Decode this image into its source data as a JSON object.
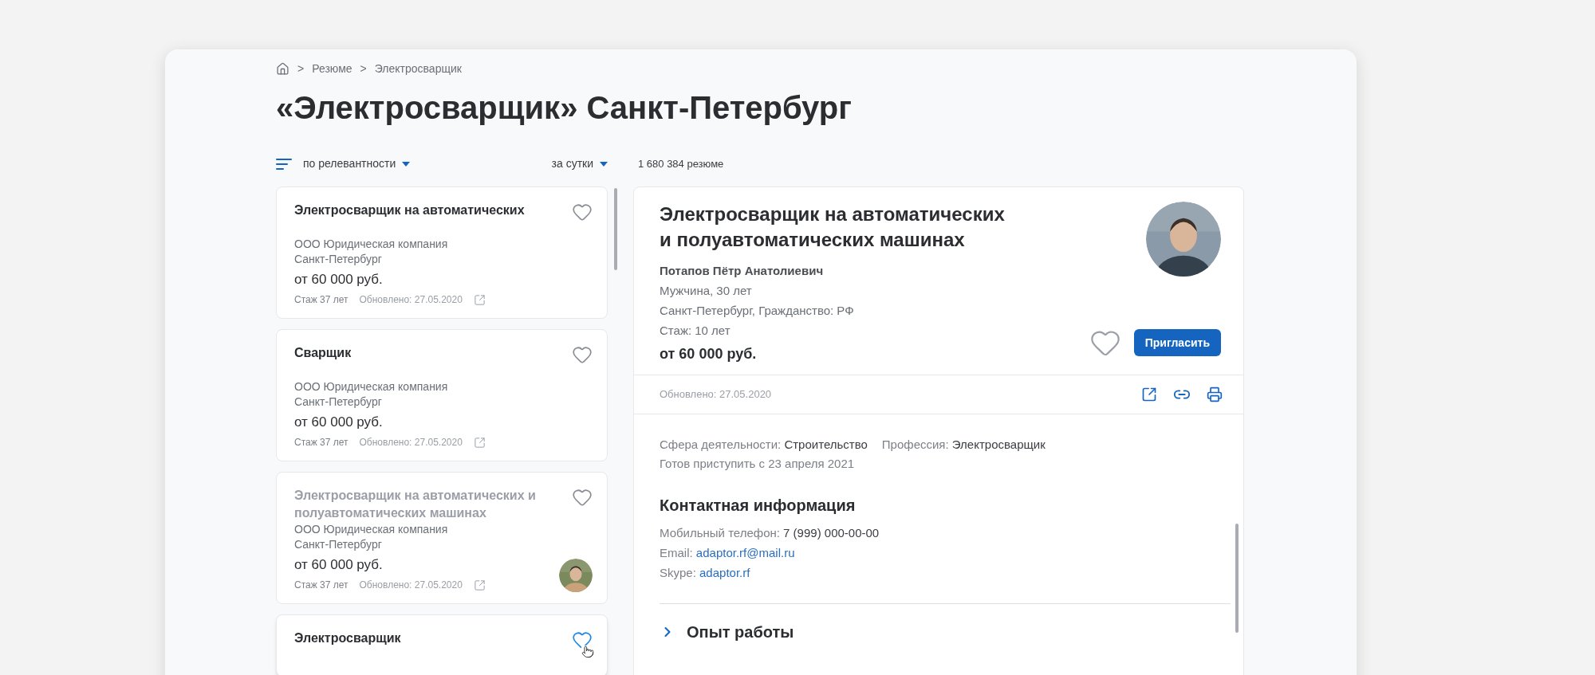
{
  "breadcrumb": [
    {
      "separator": ">",
      "label": "Резюме"
    },
    {
      "separator": ">",
      "label": "Электросварщик"
    }
  ],
  "title": "«Электросварщик» Санкт-Петербург",
  "filters": {
    "sort": "по релевантности",
    "period": "за сутки",
    "count": "1 680 384 резюме"
  },
  "results": [
    {
      "title": "Электросварщик на автоматических",
      "company": "ООО Юридическая компания",
      "city": "Санкт-Петербург",
      "salary": "от 60 000 руб.",
      "experience": "Стаж 37 лет",
      "updated": "Обновлено: 27.05.2020",
      "viewed": false,
      "favorite": false,
      "photo": false
    },
    {
      "title": "Сварщик",
      "company": "ООО Юридическая компания",
      "city": "Санкт-Петербург",
      "salary": "от 60 000 руб.",
      "experience": "Стаж 37 лет",
      "updated": "Обновлено: 27.05.2020",
      "viewed": false,
      "favorite": false,
      "photo": false
    },
    {
      "title": "Электросварщик на автоматических и полуавтоматических машинах",
      "company": "ООО Юридическая компания",
      "city": "Санкт-Петербург",
      "salary": "от 60 000 руб.",
      "experience": "Стаж 37 лет",
      "updated": "Обновлено: 27.05.2020",
      "viewed": true,
      "favorite": false,
      "photo": true
    },
    {
      "title": "Электросварщик",
      "viewed": false,
      "favorite": true
    }
  ],
  "detail": {
    "title": "Электросварщик на автоматических и полуавтоматических машинах",
    "name": "Потапов Пётр Анатолиевич",
    "person": "Мужчина, 30 лет",
    "location": "Санкт-Петербург, Гражданство: РФ",
    "experience": "Стаж: 10 лет",
    "salary": "от 60 000 руб.",
    "favorite": false,
    "invite_button": "Пригласить",
    "updated": "Обновлено: 27.05.2020",
    "fields": [
      {
        "label": "Сфера деятельности:",
        "value": "Строительство"
      },
      {
        "label": "Профессия:",
        "value": "Электросварщик"
      }
    ],
    "ready": "Готов приступить с 23 апреля 2021",
    "contacts": {
      "heading": "Контактная информация",
      "items": [
        {
          "kind": "text",
          "label": "Мобильный телефон:",
          "value": "7 (999) 000-00-00"
        },
        {
          "kind": "link",
          "label": "Email:",
          "value": "adaptor.rf@mail.ru"
        },
        {
          "kind": "link",
          "label": "Skype:",
          "value": "adaptor.rf"
        }
      ]
    },
    "sections": [
      {
        "title": "Опыт работы",
        "expanded": false
      }
    ]
  }
}
